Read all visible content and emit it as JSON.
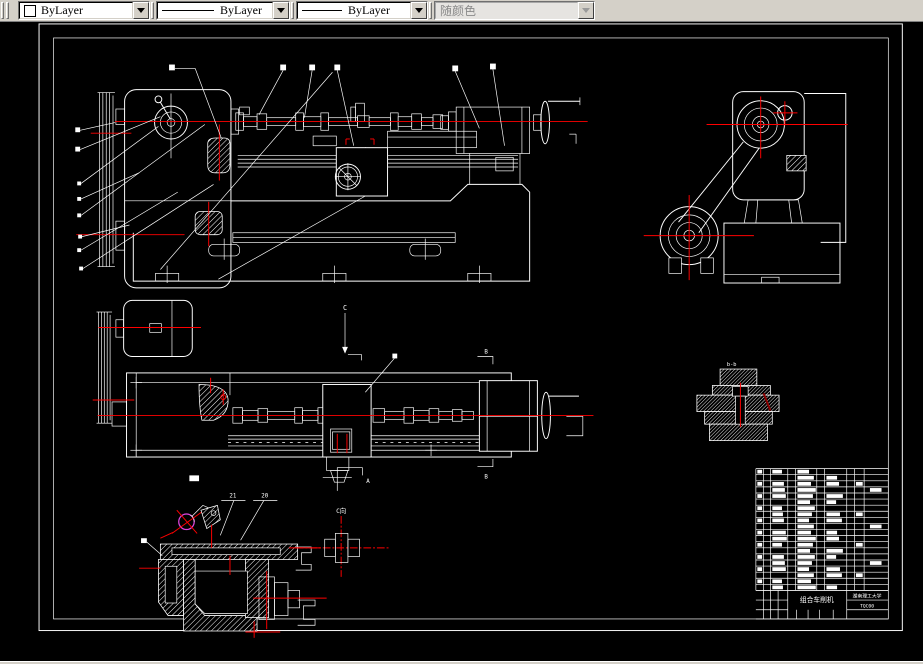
{
  "toolbar": {
    "combos": [
      {
        "id": "color",
        "value": "ByLayer",
        "swatch": "#ffffff"
      },
      {
        "id": "linetype",
        "value": "ByLayer"
      },
      {
        "id": "lineweight",
        "value": "ByLayer"
      },
      {
        "id": "plotstyle",
        "value": "随颜色",
        "disabled": true
      }
    ]
  },
  "drawing": {
    "colors": {
      "stroke": "#ffffff",
      "centerline": "#ff0000",
      "magenta": "#dd44dd",
      "dark_red": "#8b0000"
    },
    "labels": {
      "section_c": "C",
      "section_a": "A",
      "section_b_top": "B",
      "section_b_bottom": "B",
      "detail_c": "C向",
      "section_bb": "b-b",
      "balloon_21": "21",
      "balloon_20": "20"
    },
    "title_block": {
      "title": "组合车削机",
      "org": "湖南理工大学",
      "code": "TQC00",
      "rows": 20
    }
  }
}
